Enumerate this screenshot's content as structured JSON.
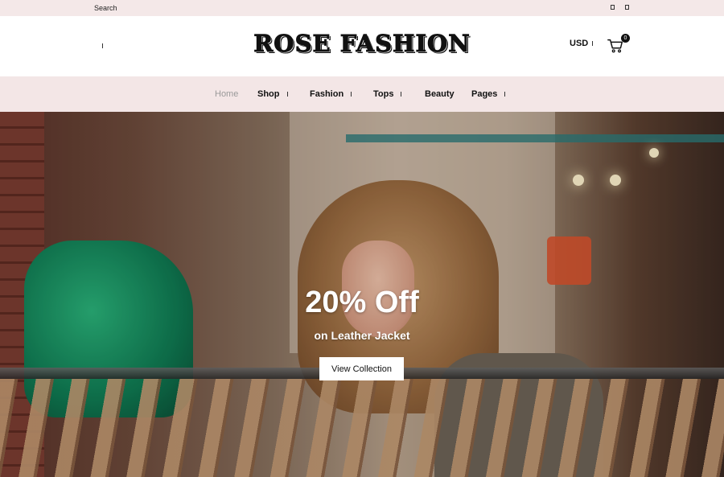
{
  "topbar": {
    "search_label": "Search",
    "social_icons": [
      "social-icon-1",
      "social-icon-2"
    ]
  },
  "header": {
    "logo_text": "ROSE FASHION",
    "currency": "USD",
    "cart_count": "0",
    "icons": {
      "menu": "hamburger-icon",
      "cart": "cart-icon"
    }
  },
  "nav": {
    "items": [
      {
        "label": "Home",
        "active": true,
        "dropdown": false
      },
      {
        "label": "Shop",
        "active": false,
        "dropdown": true
      },
      {
        "label": "Fashion",
        "active": false,
        "dropdown": true
      },
      {
        "label": "Tops",
        "active": false,
        "dropdown": true
      },
      {
        "label": "Beauty",
        "active": false,
        "dropdown": false
      },
      {
        "label": "Pages",
        "active": false,
        "dropdown": true
      }
    ]
  },
  "hero": {
    "title": "20% Off",
    "subtitle": "on Leather Jacket",
    "button_label": "View Collection"
  },
  "colors": {
    "topbar_bg": "#f4e8e8",
    "nav_bg": "#f3e6e6",
    "active_nav": "#9a9a9a",
    "text": "#111111",
    "button_bg": "#ffffff"
  }
}
